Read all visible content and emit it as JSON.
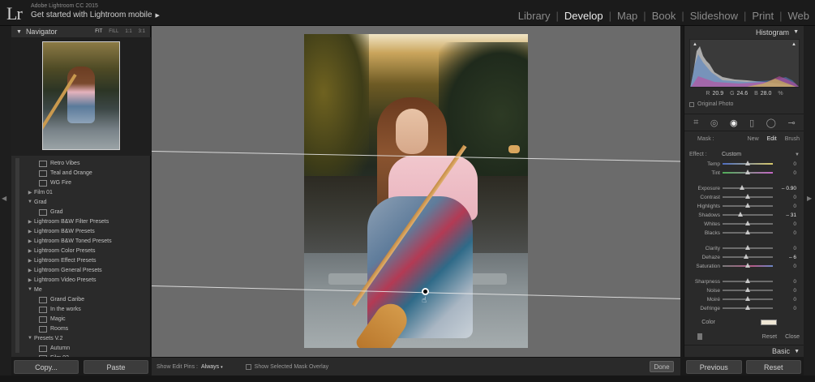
{
  "app": {
    "logo": "Lr",
    "name": "Adobe Lightroom CC 2015",
    "identity": "Get started with Lightroom mobile",
    "identity_arrow": "▶"
  },
  "modules": [
    {
      "label": "Library",
      "active": false
    },
    {
      "label": "Develop",
      "active": true
    },
    {
      "label": "Map",
      "active": false
    },
    {
      "label": "Book",
      "active": false
    },
    {
      "label": "Slideshow",
      "active": false
    },
    {
      "label": "Print",
      "active": false
    },
    {
      "label": "Web",
      "active": false
    }
  ],
  "navigator": {
    "title": "Navigator",
    "toggle": "▼",
    "modes": [
      "FIT",
      "FILL",
      "1:1",
      "3:1"
    ]
  },
  "presets": [
    {
      "label": "Retro Vibes",
      "level": 1,
      "icon": true
    },
    {
      "label": "Teal and Orange",
      "level": 1,
      "icon": true
    },
    {
      "label": "WG Fire",
      "level": 1,
      "icon": true
    },
    {
      "label": "Film 01",
      "level": 0,
      "toggle": "▶"
    },
    {
      "label": "Grad",
      "level": 0,
      "toggle": "▼"
    },
    {
      "label": "Grad",
      "level": 1,
      "icon": true
    },
    {
      "label": "Lightroom B&W Filter Presets",
      "level": 0,
      "toggle": "▶"
    },
    {
      "label": "Lightroom B&W Presets",
      "level": 0,
      "toggle": "▶"
    },
    {
      "label": "Lightroom B&W Toned Presets",
      "level": 0,
      "toggle": "▶"
    },
    {
      "label": "Lightroom Color Presets",
      "level": 0,
      "toggle": "▶"
    },
    {
      "label": "Lightroom Effect Presets",
      "level": 0,
      "toggle": "▶"
    },
    {
      "label": "Lightroom General Presets",
      "level": 0,
      "toggle": "▶"
    },
    {
      "label": "Lightroom Video Presets",
      "level": 0,
      "toggle": "▶"
    },
    {
      "label": "Me",
      "level": 0,
      "toggle": "▼"
    },
    {
      "label": "Grand Caribe",
      "level": 1,
      "icon": true
    },
    {
      "label": "In the works",
      "level": 1,
      "icon": true
    },
    {
      "label": "Magic",
      "level": 1,
      "icon": true
    },
    {
      "label": "Rooms",
      "level": 1,
      "icon": true
    },
    {
      "label": "Presets V.2",
      "level": 0,
      "toggle": "▼"
    },
    {
      "label": "Autumn",
      "level": 1,
      "icon": true
    },
    {
      "label": "Film 02",
      "level": 1,
      "icon": true
    }
  ],
  "left_buttons": {
    "copy": "Copy...",
    "paste": "Paste"
  },
  "toolbar": {
    "pins_label": "Show Edit Pins :",
    "pins_value": "Always",
    "pins_arrow": "▾",
    "overlay_label": "Show Selected Mask Overlay",
    "done": "Done"
  },
  "histogram": {
    "title": "Histogram",
    "toggle": "▼",
    "clip_left": "▲",
    "clip_right": "▲",
    "r_label": "R",
    "r": "20.9",
    "g_label": "G",
    "g": "24.6",
    "b_label": "B",
    "b": "28.0",
    "unit": "%",
    "original_photo": "Original Photo"
  },
  "tools": [
    {
      "name": "crop-tool-icon",
      "glyph": "⌗",
      "active": false
    },
    {
      "name": "spot-removal-icon",
      "glyph": "◎",
      "active": false
    },
    {
      "name": "red-eye-icon",
      "glyph": "◉",
      "active": true
    },
    {
      "name": "graduated-filter-icon",
      "glyph": "▯",
      "active": false
    },
    {
      "name": "radial-filter-icon",
      "glyph": "◯",
      "active": false
    },
    {
      "name": "adjustment-brush-icon",
      "glyph": "⊸",
      "active": false
    }
  ],
  "mask": {
    "label": "Mask :",
    "new": "New",
    "edit": "Edit",
    "brush": "Brush"
  },
  "effect": {
    "label": "Effect :",
    "value": "Custom",
    "arrow": "▼"
  },
  "sliders": [
    {
      "label": "Temp",
      "value": "0",
      "pos": 0.5,
      "track": "temp"
    },
    {
      "label": "Tint",
      "value": "0",
      "pos": 0.5,
      "track": "tint"
    },
    {
      "label": "Exposure",
      "value": "– 0.90",
      "pos": 0.38,
      "track": "",
      "hi": true
    },
    {
      "label": "Contrast",
      "value": "0",
      "pos": 0.5,
      "track": ""
    },
    {
      "label": "Highlights",
      "value": "0",
      "pos": 0.5,
      "track": ""
    },
    {
      "label": "Shadows",
      "value": "– 31",
      "pos": 0.35,
      "track": "",
      "hi": true
    },
    {
      "label": "Whites",
      "value": "0",
      "pos": 0.5,
      "track": ""
    },
    {
      "label": "Blacks",
      "value": "0",
      "pos": 0.5,
      "track": ""
    },
    {
      "label": "Clarity",
      "value": "0",
      "pos": 0.5,
      "track": ""
    },
    {
      "label": "Dehaze",
      "value": "– 6",
      "pos": 0.47,
      "track": "",
      "hi": true
    },
    {
      "label": "Saturation",
      "value": "0",
      "pos": 0.5,
      "track": "sat"
    },
    {
      "label": "Sharpness",
      "value": "0",
      "pos": 0.5,
      "track": ""
    },
    {
      "label": "Noise",
      "value": "0",
      "pos": 0.5,
      "track": ""
    },
    {
      "label": "Moiré",
      "value": "0",
      "pos": 0.5,
      "track": ""
    },
    {
      "label": "Defringe",
      "value": "0",
      "pos": 0.5,
      "track": ""
    }
  ],
  "color": {
    "label": "Color",
    "swatch": "#efe7d5"
  },
  "panel_footer": {
    "reset": "Reset",
    "close": "Close"
  },
  "basic": {
    "title": "Basic",
    "toggle": "▼"
  },
  "right_buttons": {
    "previous": "Previous",
    "reset": "Reset"
  }
}
